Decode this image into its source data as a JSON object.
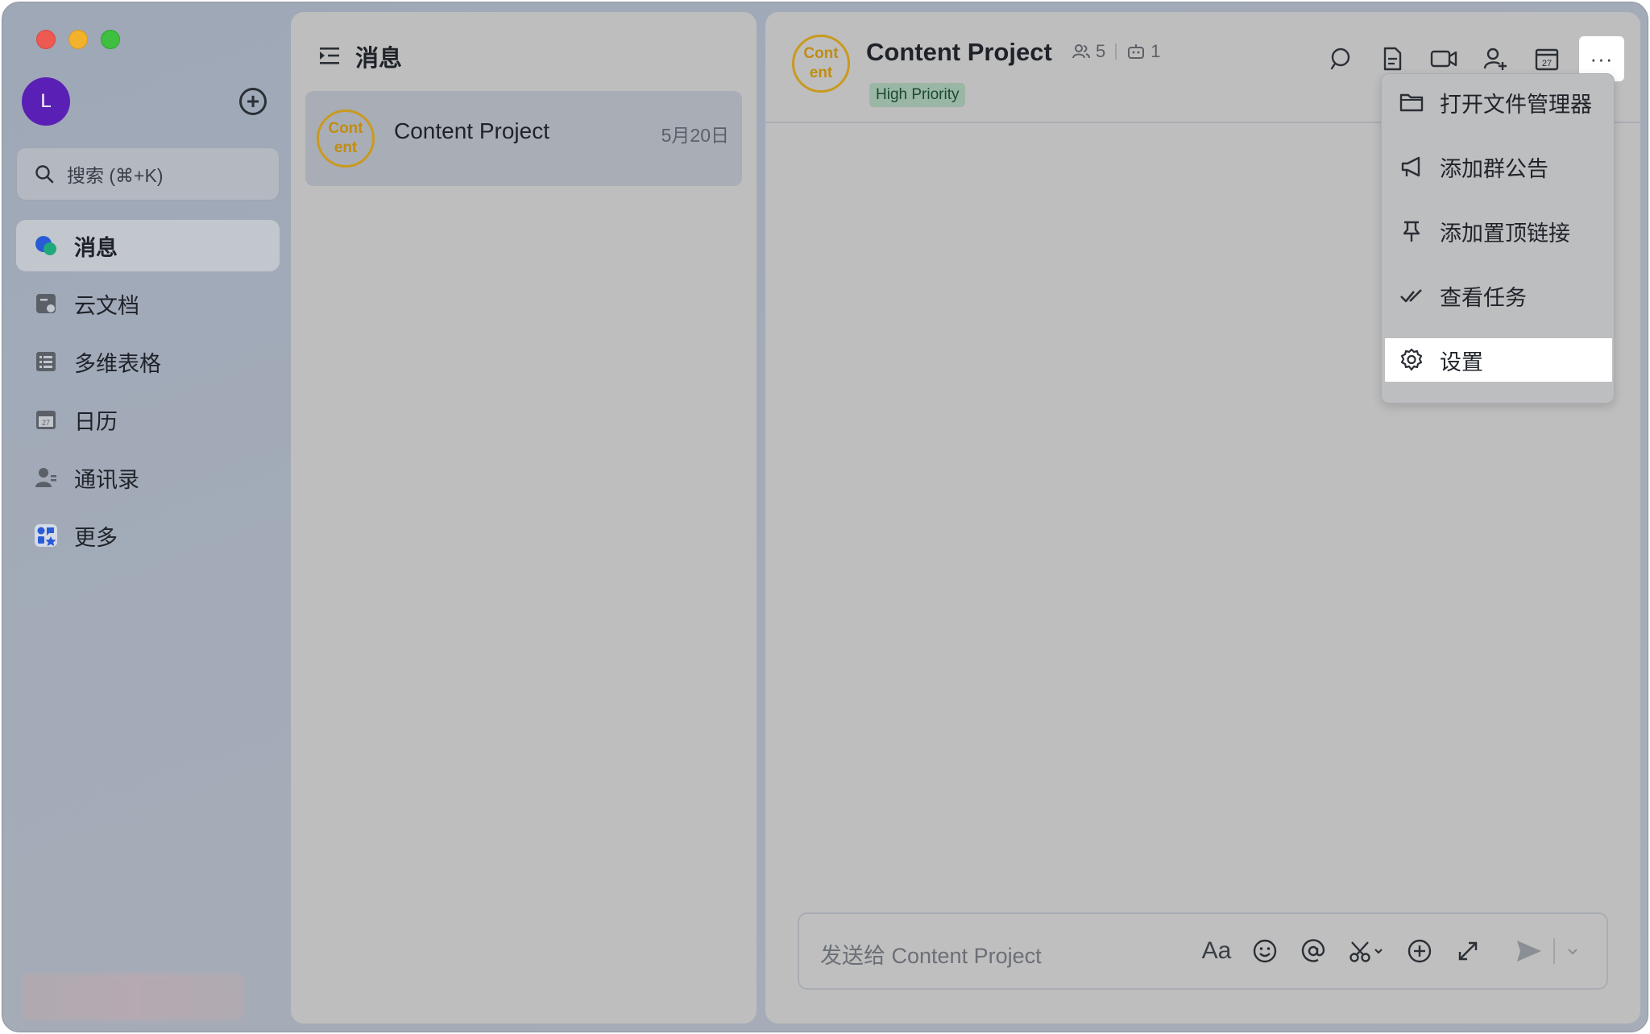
{
  "window": {
    "traffic_lights": [
      "close",
      "minimize",
      "maximize"
    ]
  },
  "sidebar": {
    "avatar_initial": "L",
    "search_placeholder": "搜索 (⌘+K)",
    "items": [
      {
        "label": "消息",
        "icon": "chat-bubbles-icon",
        "active": true
      },
      {
        "label": "云文档",
        "icon": "cloud-doc-icon",
        "active": false
      },
      {
        "label": "多维表格",
        "icon": "table-icon",
        "active": false
      },
      {
        "label": "日历",
        "icon": "calendar-icon",
        "active": false
      },
      {
        "label": "通讯录",
        "icon": "contacts-icon",
        "active": false
      },
      {
        "label": "更多",
        "icon": "apps-icon",
        "active": false
      }
    ]
  },
  "chat_list": {
    "title": "消息",
    "items": [
      {
        "avatar_text": "Cont ent",
        "name": "Content Project",
        "date": "5月20日",
        "selected": true
      }
    ]
  },
  "conversation": {
    "avatar_text": "Cont ent",
    "title": "Content Project",
    "member_count": "5",
    "bot_count": "1",
    "tag": "High Priority",
    "toolbar_icons": [
      "search-icon",
      "doc-icon",
      "video-call-icon",
      "add-member-icon",
      "calendar-icon",
      "more-icon"
    ],
    "more_label": "···",
    "input_placeholder": "发送给 Content Project",
    "input_tools": [
      "font-format-icon",
      "emoji-icon",
      "mention-icon",
      "screenshot-icon",
      "plus-icon",
      "expand-icon",
      "send-icon",
      "dropdown-icon"
    ],
    "font_label": "Aa"
  },
  "menu": {
    "items": [
      {
        "label": "打开文件管理器",
        "icon": "folder-icon",
        "selected": false
      },
      {
        "label": "添加群公告",
        "icon": "megaphone-icon",
        "selected": false
      },
      {
        "label": "添加置顶链接",
        "icon": "pin-icon",
        "selected": false
      },
      {
        "label": "查看任务",
        "icon": "task-check-icon",
        "selected": false
      },
      {
        "label": "设置",
        "icon": "gear-icon",
        "selected": true
      }
    ]
  },
  "colors": {
    "avatar_bg": "#5a20b5",
    "group_avatar_ring": "#c99a1f",
    "tag_bg": "#9ab6a4",
    "tag_text": "#1c4a2e"
  }
}
